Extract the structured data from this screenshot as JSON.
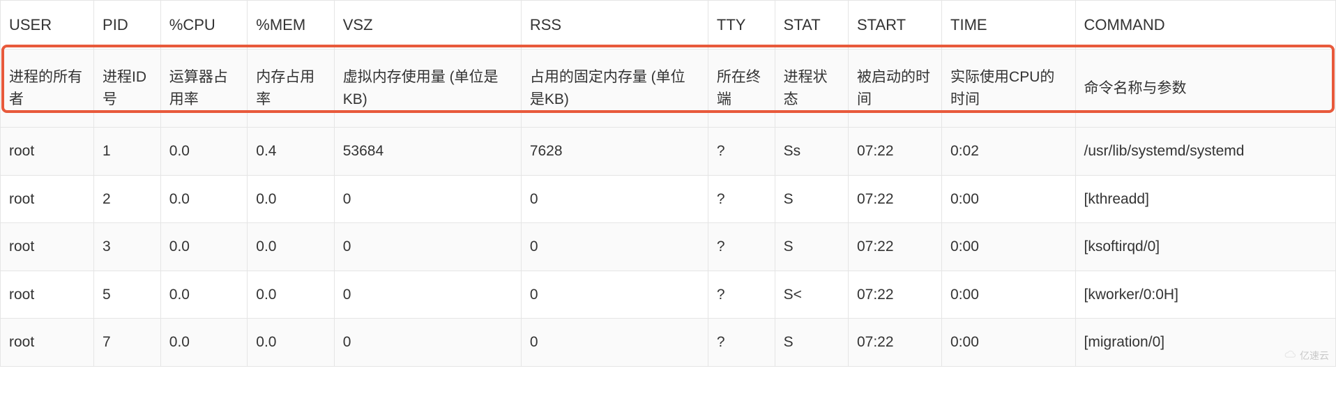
{
  "columns": [
    {
      "header": "USER",
      "desc": "进程的所有者"
    },
    {
      "header": "PID",
      "desc": "进程ID号"
    },
    {
      "header": "%CPU",
      "desc": "运算器占用率"
    },
    {
      "header": "%MEM",
      "desc": "内存占用率"
    },
    {
      "header": "VSZ",
      "desc": "虚拟内存使用量 (单位是KB)"
    },
    {
      "header": "RSS",
      "desc": "占用的固定内存量 (单位是KB)"
    },
    {
      "header": "TTY",
      "desc": "所在终端"
    },
    {
      "header": "STAT",
      "desc": "进程状态"
    },
    {
      "header": "START",
      "desc": "被启动的时间"
    },
    {
      "header": "TIME",
      "desc": "实际使用CPU的时间"
    },
    {
      "header": "COMMAND",
      "desc": "命令名称与参数"
    }
  ],
  "rows": [
    {
      "user": "root",
      "pid": "1",
      "cpu": "0.0",
      "mem": "0.4",
      "vsz": "53684",
      "rss": "7628",
      "tty": "?",
      "stat": "Ss",
      "start": "07:22",
      "time": "0:02",
      "command": "/usr/lib/systemd/systemd"
    },
    {
      "user": "root",
      "pid": "2",
      "cpu": "0.0",
      "mem": "0.0",
      "vsz": "0",
      "rss": "0",
      "tty": "?",
      "stat": "S",
      "start": "07:22",
      "time": "0:00",
      "command": "[kthreadd]"
    },
    {
      "user": "root",
      "pid": "3",
      "cpu": "0.0",
      "mem": "0.0",
      "vsz": "0",
      "rss": "0",
      "tty": "?",
      "stat": "S",
      "start": "07:22",
      "time": "0:00",
      "command": "[ksoftirqd/0]"
    },
    {
      "user": "root",
      "pid": "5",
      "cpu": "0.0",
      "mem": "0.0",
      "vsz": "0",
      "rss": "0",
      "tty": "?",
      "stat": "S<",
      "start": "07:22",
      "time": "0:00",
      "command": "[kworker/0:0H]"
    },
    {
      "user": "root",
      "pid": "7",
      "cpu": "0.0",
      "mem": "0.0",
      "vsz": "0",
      "rss": "0",
      "tty": "?",
      "stat": "S",
      "start": "07:22",
      "time": "0:00",
      "command": "[migration/0]"
    }
  ],
  "watermark": "亿速云"
}
